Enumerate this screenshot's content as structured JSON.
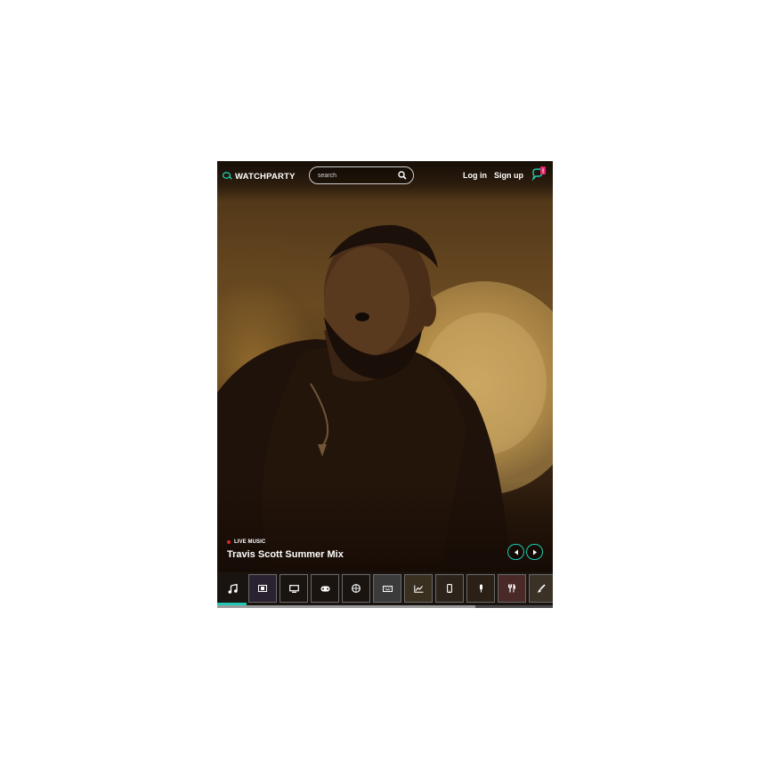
{
  "header": {
    "logo_text": "WATCHPARTY",
    "search_placeholder": "search",
    "login_label": "Log in",
    "signup_label": "Sign up",
    "chat_badge": "!"
  },
  "now_playing": {
    "category_label": "LIVE MUSIC",
    "title": "Travis Scott Summer Mix"
  },
  "categories": [
    {
      "icon": "music-note-icon",
      "active": true
    },
    {
      "icon": "film-icon"
    },
    {
      "icon": "tv-icon"
    },
    {
      "icon": "gamepad-icon"
    },
    {
      "icon": "basketball-icon"
    },
    {
      "icon": "keyboard-icon"
    },
    {
      "icon": "chart-icon"
    },
    {
      "icon": "phone-icon"
    },
    {
      "icon": "microphone-icon"
    },
    {
      "icon": "utensils-icon"
    },
    {
      "icon": "paintbrush-icon"
    }
  ],
  "colors": {
    "accent": "#1fc9b3",
    "live": "#e0262c",
    "badge": "#e6246d"
  }
}
